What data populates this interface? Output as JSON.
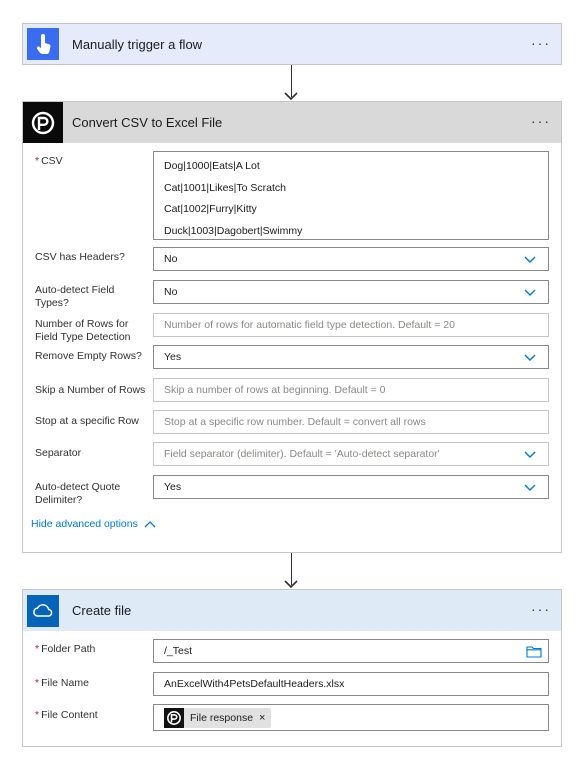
{
  "trigger": {
    "title": "Manually trigger a flow",
    "more": "···",
    "icon": "touch-hand-icon",
    "header_bg": "#e6ebfb",
    "icon_bg": "#3a6cf0"
  },
  "convert": {
    "title": "Convert CSV to Excel File",
    "more": "···",
    "icon": "plumsail-logo-icon",
    "header_bg": "#d9d9d9",
    "fields": {
      "csv": {
        "label": "CSV",
        "required": true,
        "lines": [
          "Dog|1000|Eats|A Lot",
          "Cat|1001|Likes|To Scratch",
          "Cat|1002|Furry|Kitty",
          "Duck|1003|Dagobert|Swimmy"
        ]
      },
      "headers": {
        "label": "CSV has Headers?",
        "value": "No"
      },
      "auto_detect_types": {
        "label": "Auto-detect Field Types?",
        "value": "No"
      },
      "rows_for_detection": {
        "label": "Number of Rows for Field Type Detection",
        "placeholder": "Number of rows for automatic field type detection. Default = 20"
      },
      "remove_empty": {
        "label": "Remove Empty Rows?",
        "value": "Yes"
      },
      "skip_rows": {
        "label": "Skip a Number of Rows",
        "placeholder": "Skip a number of rows at beginning. Default = 0"
      },
      "stop_row": {
        "label": "Stop at a specific Row",
        "placeholder": "Stop at a specific row number. Default = convert all rows"
      },
      "separator": {
        "label": "Separator",
        "placeholder": "Field separator (delimiter). Default = 'Auto-detect separator'"
      },
      "quote_delim": {
        "label": "Auto-detect Quote Delimiter?",
        "value": "Yes"
      }
    },
    "hide_advanced": "Hide advanced options"
  },
  "create": {
    "title": "Create file",
    "more": "···",
    "icon": "onedrive-cloud-icon",
    "header_bg": "#deeaf6",
    "fields": {
      "folder_path": {
        "label": "Folder Path",
        "required": true,
        "value": "/_Test"
      },
      "file_name": {
        "label": "File Name",
        "required": true,
        "value": "AnExcelWith4PetsDefaultHeaders.xlsx"
      },
      "file_content": {
        "label": "File Content",
        "required": true,
        "token": "File response"
      }
    }
  },
  "colors": {
    "accent": "#0078d4",
    "required": "#a4262c"
  }
}
